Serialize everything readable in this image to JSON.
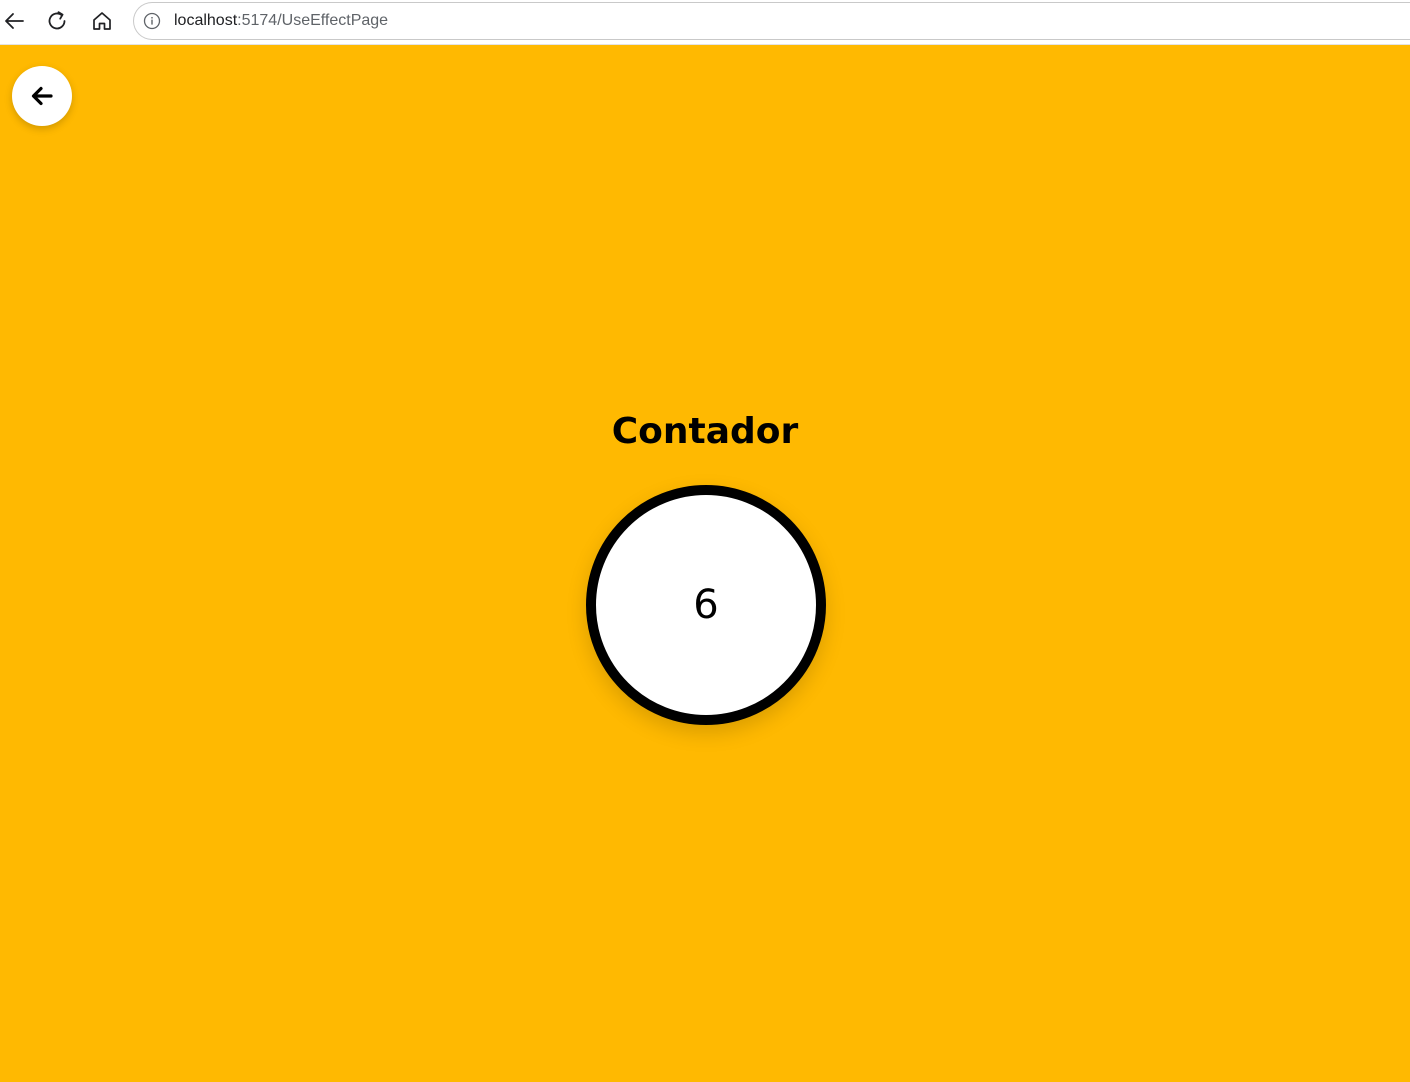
{
  "browser": {
    "url_host": "localhost",
    "url_path": ":5174/UseEffectPage",
    "icons": {
      "back": "arrow-left-icon",
      "reload": "reload-icon",
      "home": "home-icon",
      "info": "info-icon"
    }
  },
  "page": {
    "background_color": "#ffb901",
    "back_button_icon": "arrow-left-icon",
    "title": "Contador",
    "counter_value": "6"
  }
}
